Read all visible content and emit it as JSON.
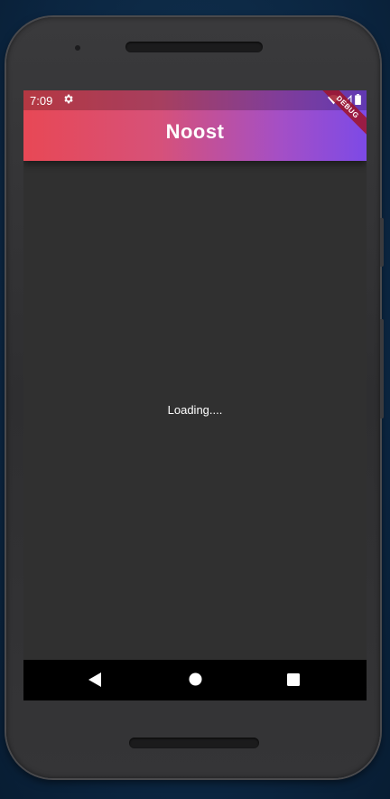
{
  "status_bar": {
    "time": "7:09",
    "settings_icon": "gear-icon",
    "wifi_icon": "wifi-icon",
    "signal_icon": "signal-icon",
    "battery_icon": "battery-icon"
  },
  "app_bar": {
    "title": "Noost",
    "gradient_colors": [
      "#e84855",
      "#d6517a",
      "#a44fc6",
      "#7d4ae6"
    ]
  },
  "debug_banner": {
    "label": "DEBUG"
  },
  "body": {
    "loading_text": "Loading....",
    "background_color": "#303030"
  },
  "nav_bar": {
    "back_icon": "back-triangle-icon",
    "home_icon": "home-circle-icon",
    "recents_icon": "recents-square-icon"
  }
}
